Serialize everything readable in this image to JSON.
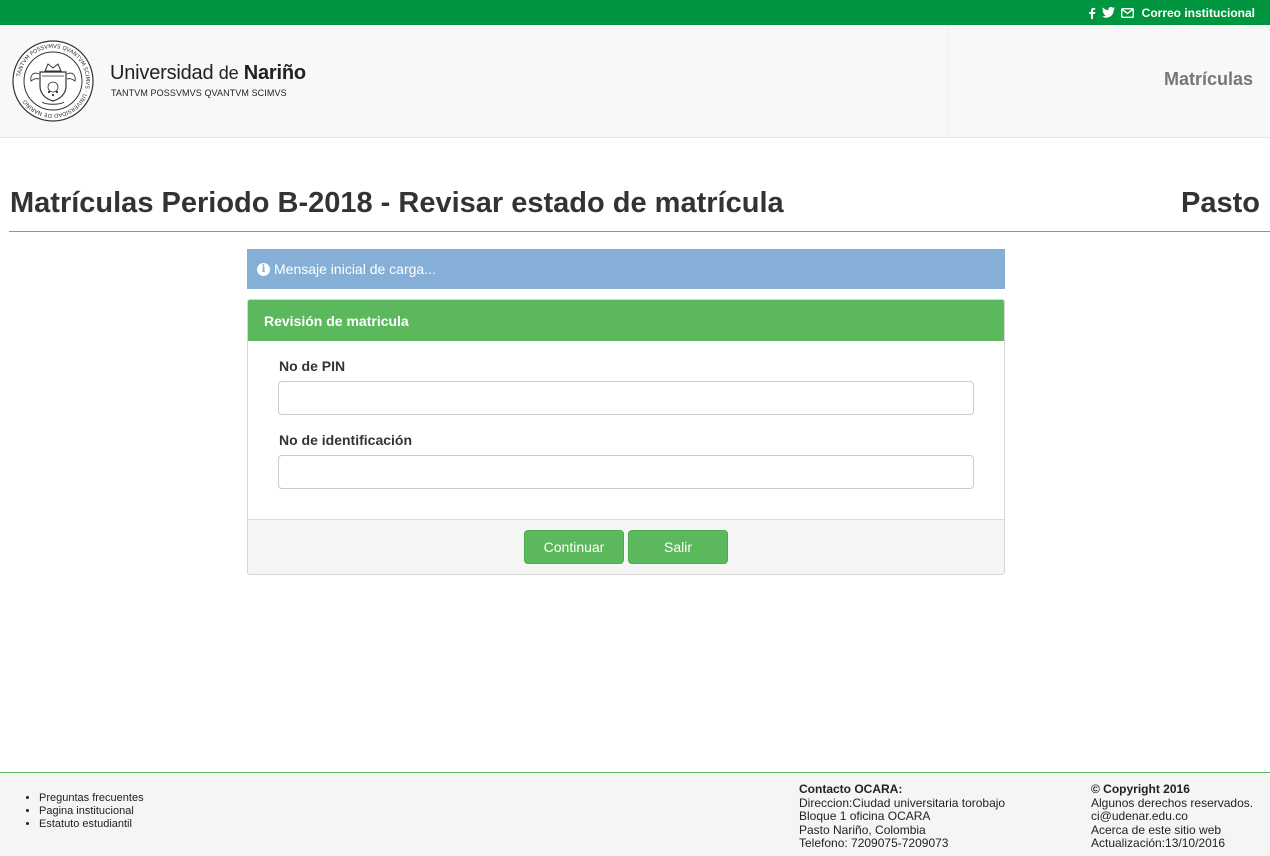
{
  "topbar": {
    "social_icons": [
      "facebook-icon",
      "twitter-icon",
      "envelope-icon"
    ],
    "mail_link": "Correo institucional"
  },
  "header": {
    "brand_name_part1": "Universidad",
    "brand_name_part2": "de",
    "brand_name_part3": "Nariño",
    "motto": "TANTVM POSSVMVS QVANTVM SCIMVS",
    "seal_text": "TANTVM POSSVMVS QVANTVM SCIMVS · UNIVERSIDAD DE NARIÑO",
    "nav_item": "Matrículas"
  },
  "page": {
    "title": "Matrículas Periodo B-2018 - Revisar estado de matrícula",
    "campus": "Pasto"
  },
  "alert": {
    "icon": "info-circle-icon",
    "message": "Mensaje inicial de carga..."
  },
  "panel": {
    "heading": "Revisión de matricula",
    "fields": [
      {
        "label": "No de PIN",
        "value": "",
        "placeholder": ""
      },
      {
        "label": "No de identificación",
        "value": "",
        "placeholder": ""
      }
    ],
    "buttons": {
      "continue": "Continuar",
      "exit": "Salir"
    }
  },
  "footer": {
    "links": [
      "Preguntas frecuentes",
      "Pagina institucional",
      "Estatuto estudiantil"
    ],
    "contact": {
      "heading": "Contacto OCARA:",
      "lines": [
        "Direccion:Ciudad universitaria torobajo",
        "Bloque 1 oficina OCARA",
        "Pasto Nariño, Colombia",
        "Telefono: 7209075-7209073"
      ]
    },
    "copyright": {
      "heading": "© Copyright 2016",
      "lines": [
        "Algunos derechos reservados.",
        "ci@udenar.edu.co",
        "Acerca de este sitio web",
        "Actualización:13/10/2016"
      ]
    }
  },
  "colors": {
    "brand_green": "#00963f",
    "panel_green": "#5cb85c",
    "alert_blue": "#85afd6"
  }
}
